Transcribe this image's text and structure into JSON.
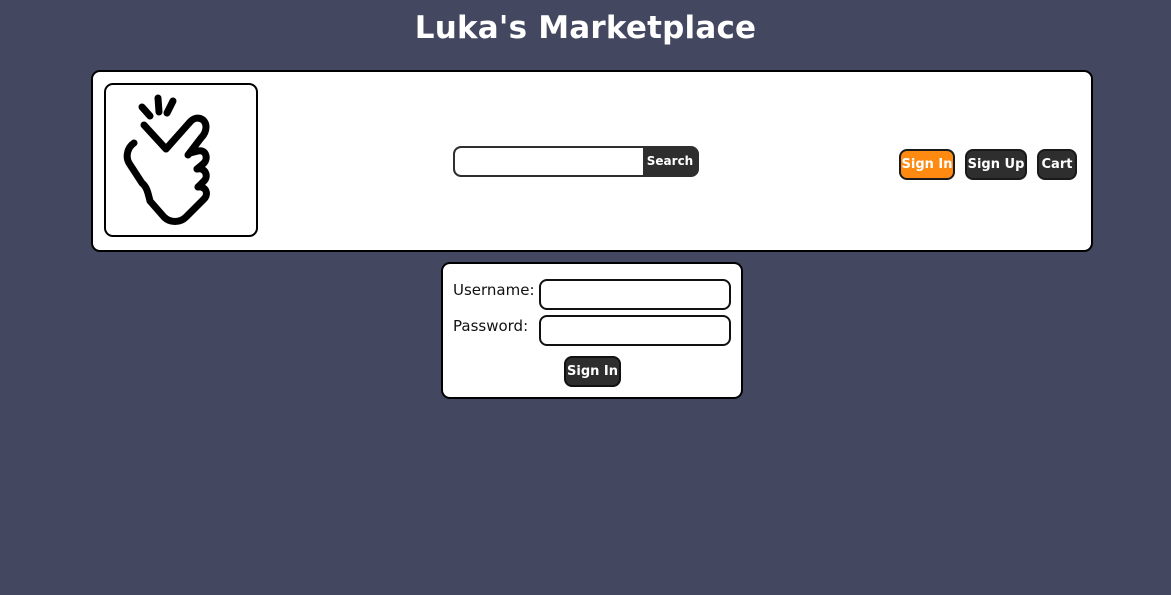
{
  "site": {
    "title": "Luka's Marketplace"
  },
  "header": {
    "logo_icon": "snapping-fingers-icon",
    "search": {
      "value": "",
      "placeholder": "",
      "button_label": "Search",
      "icon": "none"
    },
    "nav": {
      "sign_in_label": "Sign In",
      "sign_up_label": "Sign Up",
      "cart_label": "Cart",
      "active_item": "Sign In"
    }
  },
  "login_form": {
    "username_label": "Username:",
    "username_value": "",
    "password_label": "Password:",
    "password_value": "",
    "submit_label": "Sign In"
  },
  "colors": {
    "background": "#434760",
    "panel": "#ffffff",
    "button_dark": "#2e2e2e",
    "button_active": "#ff8a12",
    "text_light": "#ffffff"
  }
}
